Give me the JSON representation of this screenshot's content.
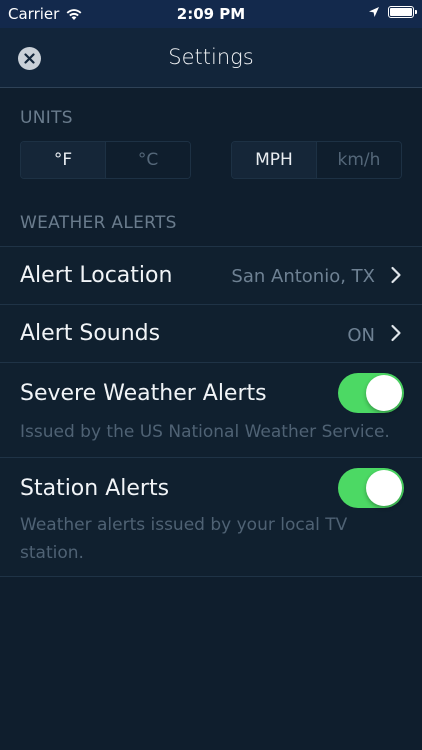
{
  "status_bar": {
    "carrier": "Carrier",
    "time": "2:09 PM",
    "battery_level": 1.0
  },
  "header": {
    "title": "Settings",
    "close_icon": "close-icon"
  },
  "units": {
    "section_label": "UNITS",
    "temperature": {
      "options": [
        "°F",
        "°C"
      ],
      "selected": "°F"
    },
    "speed": {
      "options": [
        "MPH",
        "km/h"
      ],
      "selected": "MPH"
    }
  },
  "weather_alerts": {
    "section_label": "WEATHER ALERTS",
    "alert_location": {
      "label": "Alert Location",
      "value": "San Antonio, TX"
    },
    "alert_sounds": {
      "label": "Alert Sounds",
      "value": "ON"
    },
    "severe_weather": {
      "label": "Severe Weather Alerts",
      "description": "Issued by the US National Weather Service.",
      "enabled": true
    },
    "station_alerts": {
      "label": "Station Alerts",
      "description": "Weather alerts issued by your local TV station.",
      "enabled": true
    }
  },
  "colors": {
    "toggle_on": "#4cd964",
    "background": "#0f1e2d",
    "status_bar": "#13294c"
  }
}
